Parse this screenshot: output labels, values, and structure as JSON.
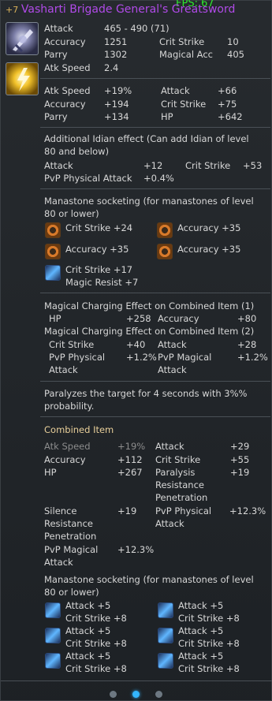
{
  "fps": "FPS: 67",
  "title": {
    "plus": "+7",
    "name": "Vasharti Brigade General's Greatsword"
  },
  "base": {
    "attack_label": "Attack",
    "attack_value": "465 - 490 (71)",
    "accuracy_label": "Accuracy",
    "accuracy_value": "1251",
    "crit_label": "Crit Strike",
    "crit_value": "10",
    "parry_label": "Parry",
    "parry_value": "1302",
    "macc_label": "Magical Acc",
    "macc_value": "405",
    "atkspd_label": "Atk Speed",
    "atkspd_value": "2.4"
  },
  "enchant": {
    "rows": [
      [
        "Atk Speed",
        "+19%",
        "Attack",
        "+66"
      ],
      [
        "Accuracy",
        "+194",
        "Crit Strike",
        "+75"
      ],
      [
        "Parry",
        "+134",
        "HP",
        "+642"
      ]
    ]
  },
  "idian": {
    "header1": "Additional Idian effect (Can add Idian of level",
    "header2": "80 and below)",
    "attack_label": "Attack",
    "attack_value": "+12",
    "crit_label": "Crit Strike",
    "crit_value": "+53",
    "pvp_label": "PvP Physical Attack",
    "pvp_value": "+0.4%"
  },
  "manastones": {
    "header1": "Manastone socketing (for manastones of level",
    "header2": "80 or lower)",
    "s1": "Crit Strike +24",
    "s2": "Accuracy +35",
    "s3": "Accuracy +35",
    "s4": "Accuracy +35",
    "s5a": "Crit Strike +17",
    "s5b": "Magic Resist +7"
  },
  "charging": {
    "header1": "Magical Charging Effect on Combined Item (1)",
    "hp_label": "HP",
    "hp_value": "+258",
    "acc_label": "Accuracy",
    "acc_value": "+80",
    "header2": "Magical Charging Effect on Combined Item (2)",
    "crit_label": "Crit Strike",
    "crit_value": "+40",
    "att_label": "Attack",
    "att_value": "+28",
    "pvpphys_label_a": "PvP Physical",
    "pvpphys_label_b": "Attack",
    "pvpphys_value": "+1.2%",
    "pvpmag_label_a": "PvP Magical",
    "pvpmag_label_b": "Attack",
    "pvpmag_value": "+1.2%"
  },
  "proc": {
    "line1": "Paralyzes the target for 4 seconds with 3%%",
    "line2": "probability."
  },
  "combined": {
    "header": "Combined Item",
    "atkspd_label": "Atk Speed",
    "atkspd_value": "+19%",
    "attack_label": "Attack",
    "attack_value": "+29",
    "acc_label": "Accuracy",
    "acc_value": "+112",
    "crit_label": "Crit Strike",
    "crit_value": "+55",
    "hp_label": "HP",
    "hp_value": "+267",
    "paralysis_a": "Paralysis",
    "paralysis_b": "Resistance",
    "paralysis_c": "Penetration",
    "paralysis_value": "+19",
    "silence_a": "Silence",
    "silence_b": "Resistance",
    "silence_c": "Penetration",
    "silence_value": "+19",
    "pvpphys_a": "PvP Physical",
    "pvpphys_b": "Attack",
    "pvpphys_value": "+12.3%",
    "pvpmag_a": "PvP Magical",
    "pvpmag_b": "Attack",
    "pvpmag_value": "+12.3%"
  },
  "combined_manastones": {
    "header1": "Manastone socketing (for manastones of level",
    "header2": "80 or lower)",
    "a": "Attack +5",
    "b": "Crit Strike +8"
  },
  "pager": {
    "count": 3,
    "active": 2
  }
}
